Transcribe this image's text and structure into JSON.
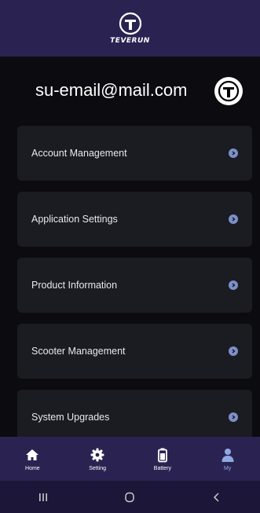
{
  "brand": {
    "logo_text": "TEVERUN"
  },
  "account": {
    "email": "su-email@mail.com"
  },
  "menu": [
    {
      "label": "Account Management"
    },
    {
      "label": "Application Settings"
    },
    {
      "label": "Product Information"
    },
    {
      "label": "Scooter Management"
    },
    {
      "label": "System Upgrades"
    }
  ],
  "tabs": [
    {
      "label": "Home",
      "icon": "home-icon"
    },
    {
      "label": "Setting",
      "icon": "gear-icon"
    },
    {
      "label": "Battery",
      "icon": "battery-icon"
    },
    {
      "label": "My",
      "icon": "person-icon",
      "active": true
    }
  ],
  "colors": {
    "header_bg": "#2a2352",
    "body_bg": "#0b0b10",
    "card_bg": "#1b1b22",
    "accent": "#7c8fc7"
  }
}
